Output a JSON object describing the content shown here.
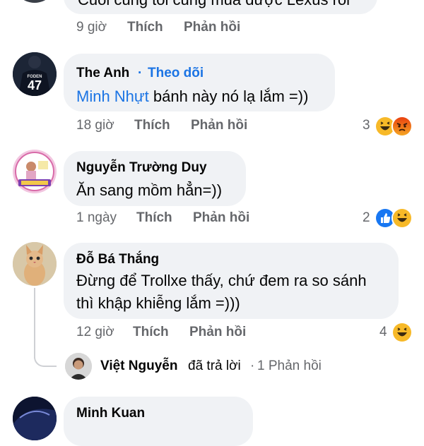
{
  "comments": [
    {
      "text": "Cuối cùng tôi cũng mua được Lexus rồi",
      "time": "9 giờ",
      "like": "Thích",
      "reply": "Phản hồi"
    },
    {
      "author": "The Anh",
      "follow_sep": "·",
      "follow": "Theo dõi",
      "mention": "Minh Nhựt",
      "text": " bánh này nó lạ lắm =))",
      "time": "18 giờ",
      "like": "Thích",
      "reply": "Phản hồi",
      "reaction_count": "3",
      "reactions": [
        "haha-icon",
        "angry-icon"
      ],
      "jersey_name": "FODEN",
      "jersey_number": "47"
    },
    {
      "author": "Nguyễn Trường Duy",
      "text": "Ăn sang mồm hẳn=))",
      "time": "1 ngày",
      "like": "Thích",
      "reply": "Phản hồi",
      "reaction_count": "2",
      "reactions": [
        "like-icon",
        "haha-icon"
      ]
    },
    {
      "author": "Đỗ Bá Thắng",
      "text_line1": "Đừng để Trollxe thấy, chứ đem ra so sánh",
      "text_line2": "thì khập khiễng lắm =)))",
      "time": "12 giờ",
      "like": "Thích",
      "reply": "Phản hồi",
      "reaction_count": "4",
      "reactions": [
        "haha-icon"
      ],
      "replies_summary": {
        "name": "Việt Nguyễn",
        "action": "đã trả lời",
        "sep": "·",
        "count": "1 Phản hồi"
      }
    },
    {
      "author": "Minh Kuan"
    }
  ],
  "colors": {
    "bubble": "#f0f2f5",
    "link": "#1b74e4",
    "meta": "#65676b",
    "like_blue": "#1877f2",
    "haha_yellow": "#f7b928",
    "angry_orange": "#e9710f"
  }
}
